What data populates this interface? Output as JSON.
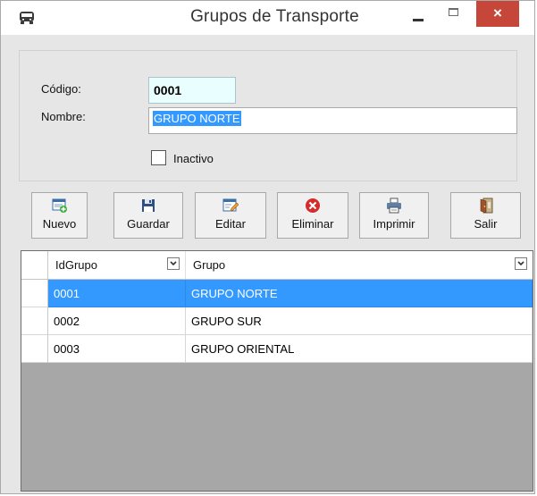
{
  "window": {
    "title": "Grupos de Transporte",
    "icon": "bus-icon",
    "close_glyph": "×"
  },
  "form": {
    "codigo_label": "Código:",
    "codigo_value": "0001",
    "nombre_label": "Nombre:",
    "nombre_value": "GRUPO NORTE",
    "inactivo_label": "Inactivo",
    "inactivo_checked": false
  },
  "toolbar": {
    "nuevo": "Nuevo",
    "guardar": "Guardar",
    "editar": "Editar",
    "eliminar": "Eliminar",
    "imprimir": "Imprimir",
    "salir": "Salir"
  },
  "grid": {
    "columns": [
      "IdGrupo",
      "Grupo"
    ],
    "rows": [
      {
        "id": "0001",
        "grupo": "GRUPO NORTE",
        "selected": true
      },
      {
        "id": "0002",
        "grupo": "GRUPO SUR",
        "selected": false
      },
      {
        "id": "0003",
        "grupo": "GRUPO ORIENTAL",
        "selected": false
      }
    ]
  },
  "colors": {
    "selection": "#3399ff",
    "close_button": "#c7463a",
    "codigo_bg": "#e8feff",
    "grid_bg": "#a7a7a7"
  }
}
